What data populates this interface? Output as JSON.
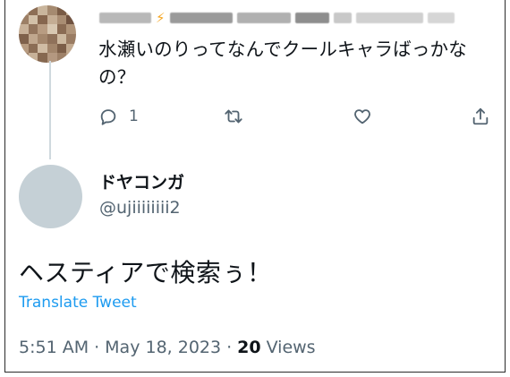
{
  "parent_tweet": {
    "text": "水瀬いのりってなんでクールキャラばっかなの？",
    "actions": {
      "reply_count": "1",
      "reply_icon": "reply-icon",
      "retweet_icon": "retweet-icon",
      "like_icon": "like-icon",
      "share_icon": "share-icon"
    }
  },
  "main_tweet": {
    "display_name": "ドヤコンガ",
    "handle": "@ujiiiiiiii2",
    "text": "ヘスティアで検索ぅ！",
    "translate_label": "Translate Tweet",
    "time": "5:51 AM",
    "separator": "·",
    "date": "May 18, 2023",
    "views_count": "20",
    "views_label": "Views"
  },
  "colors": {
    "text_primary": "#0f1419",
    "text_secondary": "#536471",
    "link": "#1d9bf0",
    "avatar_placeholder": "#c5d0d6",
    "thread_line": "#cfd9de"
  }
}
